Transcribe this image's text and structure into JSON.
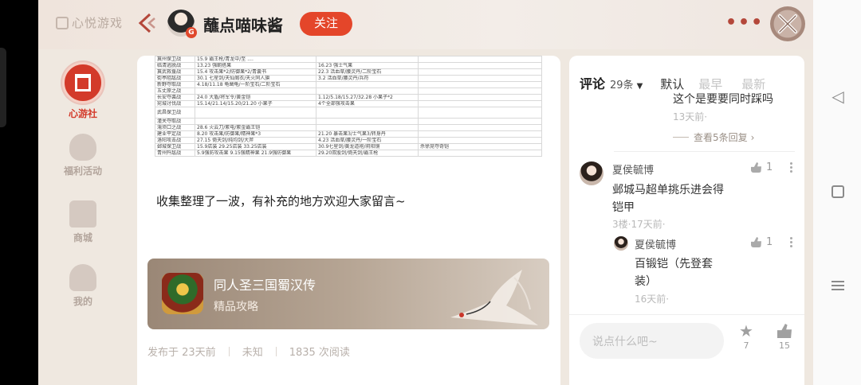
{
  "header": {
    "brand": "心悦游戏",
    "username": "蘸点喵味酱",
    "avatar_badge": "G",
    "follow_label": "关注",
    "more_label": "•••"
  },
  "sidebar": {
    "items": [
      {
        "label": "心游社",
        "icon": "temple-icon",
        "active": true
      },
      {
        "label": "福利活动",
        "icon": "gift-bag-icon",
        "active": false
      },
      {
        "label": "商城",
        "icon": "shop-icon",
        "active": false
      },
      {
        "label": "我的",
        "icon": "helmet-icon",
        "active": false
      }
    ]
  },
  "article": {
    "table_rows": [
      [
        "冀州保卫战",
        "15.9 霸王枪/青龙中/至 ....",
        "",
        ""
      ],
      [
        "临清逃脱战",
        "13.23 强朝搭果",
        "16.23 强士气果",
        ""
      ],
      [
        "冀武救援战",
        "15.4 攻击果*2/防御果*2/青囊书",
        "22.3 活血草/腰灵丹/二阶宝石",
        ""
      ],
      [
        "街亭阻敌战",
        "30.1 七星剑/天仙阁衣/天火同人旗",
        "3.2 活血草/腰灵丹/兵符",
        ""
      ],
      [
        "新野夺取战",
        "4.18/11.18 龟凿龟/一阶宝石/二阶宝石",
        "",
        ""
      ],
      [
        "五丈原之战",
        "",
        "",
        ""
      ],
      [
        "长安夺袭战",
        "24.0 大盾/将军令/黄金铠",
        "1.12/5.18/15.27/32.28 小果子*2",
        ""
      ],
      [
        "宛城讨伐战",
        "15.14/21.14/15.20/21.20 小果子",
        "4个全部强攻击果",
        ""
      ],
      [
        "武昌保卫战",
        "",
        "",
        ""
      ],
      [
        "潼关夺取战",
        "",
        "",
        ""
      ],
      [
        "濡须口之战",
        "28.6 火云刀/紫电/紫金霸王铠",
        "",
        ""
      ],
      [
        "建业平定战",
        "8.20 攻击果/防御果/精神果*3",
        "21.20 暴击果3/士气果3/转身丹",
        ""
      ],
      [
        "洛阳攻击战",
        "27.15 倚天剑/纯均剑/大斧",
        "4.23 活血草/腰灵丹/一阶宝石",
        ""
      ],
      [
        "邺城保卫战",
        "15.9店装 29.25店装 33.25店装",
        "30.9七星剑/黄龙道袍/阴阳镜",
        "杀徐晃夺奇铠"
      ],
      [
        "青州歼敌战",
        "5.9强防攻击果 9.15强精神果 21.9强防御果",
        "29.20双股剑/倚天剑/霸王枪",
        ""
      ]
    ],
    "body_text": "收集整理了一波，有补充的地方欢迎大家留言~",
    "game_card": {
      "title": "同人圣三国蜀汉传",
      "subtitle": "精品攻略"
    },
    "meta": {
      "posted": "发布于 23天前",
      "location": "未知",
      "reads": "1835 次阅读"
    }
  },
  "comments": {
    "title": "评论",
    "count": "29条",
    "sort_options": [
      "默认",
      "最早",
      "最新"
    ],
    "top_reply": {
      "text": "这个是要要同时踩吗",
      "time": "13天前·"
    },
    "view_more": "查看5条回复",
    "items": [
      {
        "name": "夏侯毓博",
        "likes": "1",
        "text_line1": "邺城马超单挑乐进会得",
        "text_line2": "铠甲",
        "meta": "3楼·17天前·",
        "reply": {
          "name": "夏侯毓博",
          "likes": "1",
          "text_line1": "百锻铠（先登套",
          "text_line2": "装）",
          "time": "16天前·"
        }
      }
    ],
    "input_placeholder": "说点什么吧~",
    "favorites": "7",
    "thumbs": "15"
  },
  "colors": {
    "accent_red": "#e4462a",
    "background": "#efe8e0"
  }
}
